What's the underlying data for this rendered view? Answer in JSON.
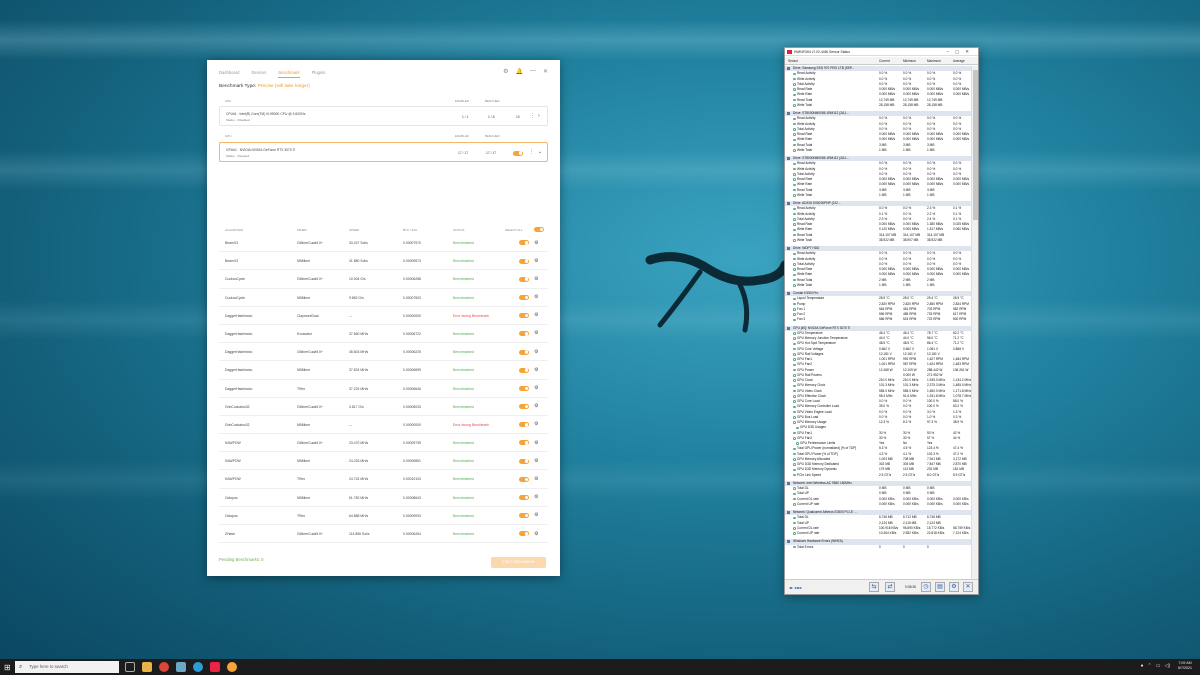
{
  "app": {
    "nav": [
      "Dashboard",
      "Devices",
      "Benchmark",
      "Plugins"
    ],
    "nav_active": 2,
    "benchmark_type_label": "Benchmark Type:",
    "benchmark_type_value": "Precise (will take longer)",
    "cpu_section": {
      "header": "CPU",
      "col_enabled": "ENABLED",
      "col_bench": "BENCHED",
      "device": "CPU#1 · Intel(R) Core(TM) i9-9900K CPU @ 3.60GHz",
      "status": "Status · Disabled",
      "enabled": "1 / 1",
      "benched": "1 / 8",
      "extra": "10"
    },
    "gpu_section": {
      "header": "GPU",
      "col_enabled": "ENABLED",
      "col_bench": "BENCHED",
      "device": "GPU#1 · NVIDIA NVIDIA GeForce RTX 3070 Ti",
      "status": "Status · Stopped",
      "enabled": "17 / 17",
      "benched": "17 / 17"
    },
    "algo_headers": {
      "algorithm": "ALGORITHM",
      "miner": "MINER",
      "speed": "SPEED",
      "btc": "BTC / 24H",
      "status": "STATUS",
      "select_all": "SELECT ALL"
    },
    "algorithms": [
      {
        "algo": "BeamV3",
        "miner": "GMinerCuda9.0+",
        "speed": "33.247 Sol/s",
        "btc": "0.00007970",
        "status": "Benchmarked",
        "err": false
      },
      {
        "algo": "BeamV3",
        "miner": "NBMiner",
        "speed": "41.880 Sol/s",
        "btc": "0.00009573",
        "status": "Benchmarked",
        "err": false
      },
      {
        "algo": "CuckooCycle",
        "miner": "GMinerCuda9.0+",
        "speed": "10.004 G/s",
        "btc": "0.00006288",
        "status": "Benchmarked",
        "err": false
      },
      {
        "algo": "CuckooCycle",
        "miner": "NBMiner",
        "speed": "9.852 G/s",
        "btc": "0.00007503",
        "status": "Benchmarked",
        "err": false
      },
      {
        "algo": "DaggerHashimoto",
        "miner": "ClaymoreDual",
        "speed": "---",
        "btc": "0.00000000",
        "status": "Error during Benchmark",
        "err": true
      },
      {
        "algo": "DaggerHashimoto",
        "miner": "Excavator",
        "speed": "37.650 MH/s",
        "btc": "0.00006722",
        "status": "Benchmarked",
        "err": false
      },
      {
        "algo": "DaggerHashimoto",
        "miner": "GMinerCuda9.0+",
        "speed": "38.603 MH/s",
        "btc": "0.00006225",
        "status": "Benchmarked",
        "err": false
      },
      {
        "algo": "DaggerHashimoto",
        "miner": "NBMiner",
        "speed": "37.524 MH/s",
        "btc": "0.00006699",
        "status": "Benchmarked",
        "err": false
      },
      {
        "algo": "DaggerHashimoto",
        "miner": "TRex",
        "speed": "37.224 MH/s",
        "btc": "0.00006646",
        "status": "Benchmarked",
        "err": false
      },
      {
        "algo": "GrinCuckatoo32",
        "miner": "GMinerCuda9.0+",
        "speed": "0.817 G/s",
        "btc": "0.00005033",
        "status": "Benchmarked",
        "err": false
      },
      {
        "algo": "GrinCuckatoo32",
        "miner": "NBMiner",
        "speed": "---",
        "btc": "0.00000000",
        "status": "Error during Benchmark",
        "err": true
      },
      {
        "algo": "KAWPOW",
        "miner": "GMinerCuda9.0+",
        "speed": "23.470 MH/s",
        "btc": "0.00009739",
        "status": "Benchmarked",
        "err": false
      },
      {
        "algo": "KAWPOW",
        "miner": "NBMiner",
        "speed": "24.233 MH/s",
        "btc": "0.00009851",
        "status": "Benchmarked",
        "err": false
      },
      {
        "algo": "KAWPOW",
        "miner": "TRex",
        "speed": "24.724 MH/s",
        "btc": "0.00010103",
        "status": "Benchmarked",
        "err": false
      },
      {
        "algo": "Octopus",
        "miner": "NBMiner",
        "speed": "61.782 MH/s",
        "btc": "0.00008643",
        "status": "Benchmarked",
        "err": false
      },
      {
        "algo": "Octopus",
        "miner": "TRex",
        "speed": "64.888 MH/s",
        "btc": "0.00009093",
        "status": "Benchmarked",
        "err": false
      },
      {
        "algo": "ZHash",
        "miner": "GMinerCuda9.0+",
        "speed": "114.856 Sol/s",
        "btc": "0.00006264",
        "status": "Benchmarked",
        "err": false
      }
    ],
    "pending": "Pending Benchmarks: 0",
    "start_button": "START BENCHMARK",
    "accent": "#f09a32"
  },
  "hw": {
    "title": "HWiNFO64 v7.02-4460 Sensor Status",
    "columns": [
      "Sensor",
      "Current",
      "Minimum",
      "Maximum",
      "Average"
    ],
    "time": "0:05:26",
    "rows": [
      {
        "g": "Drive: Samsung SSD 970 PRO 1TB (S5P..."
      },
      [
        "Read Activity",
        "0.0 %",
        "0.0 %",
        "0.0 %",
        "0.0 %"
      ],
      [
        "Write Activity",
        "0.0 %",
        "0.0 %",
        "0.0 %",
        "0.0 %"
      ],
      [
        "Total Activity",
        "0.0 %",
        "0.0 %",
        "0.0 %",
        "0.0 %"
      ],
      [
        "Read Rate",
        "0.000 MB/s",
        "0.000 MB/s",
        "0.000 MB/s",
        "0.000 MB/s"
      ],
      [
        "Write Rate",
        "0.000 MB/s",
        "0.000 MB/s",
        "0.000 MB/s",
        "0.000 MB/s"
      ],
      [
        "Read Total",
        "12,749 MB",
        "12,749 MB",
        "12,749 MB",
        ""
      ],
      [
        "Write Total",
        "28,158 MB",
        "28,158 MB",
        "28,158 MB",
        ""
      ],
      {
        "sp": 1
      },
      {
        "g": "Drive: ST8000NM0055-1RM112 (ZA1..."
      },
      [
        "Read Activity",
        "0.0 %",
        "0.0 %",
        "0.0 %",
        "0.0 %"
      ],
      [
        "Write Activity",
        "0.0 %",
        "0.0 %",
        "0.0 %",
        "0.0 %"
      ],
      [
        "Total Activity",
        "0.0 %",
        "0.0 %",
        "0.0 %",
        "0.0 %"
      ],
      [
        "Read Rate",
        "0.000 MB/s",
        "0.000 MB/s",
        "0.000 MB/s",
        "0.000 MB/s"
      ],
      [
        "Write Rate",
        "0.000 MB/s",
        "0.000 MB/s",
        "0.000 MB/s",
        "0.000 MB/s"
      ],
      [
        "Read Total",
        "3 MB",
        "3 MB",
        "3 MB",
        ""
      ],
      [
        "Write Total",
        "1 MB",
        "1 MB",
        "1 MB",
        ""
      ],
      {
        "sp": 1
      },
      {
        "g": "Drive: ST8000NM0055-1RM112 (ZA1..."
      },
      [
        "Read Activity",
        "0.0 %",
        "0.0 %",
        "0.0 %",
        "0.0 %"
      ],
      [
        "Write Activity",
        "0.0 %",
        "0.0 %",
        "0.0 %",
        "0.0 %"
      ],
      [
        "Total Activity",
        "0.0 %",
        "0.0 %",
        "0.0 %",
        "0.0 %"
      ],
      [
        "Read Rate",
        "0.000 MB/s",
        "0.000 MB/s",
        "0.000 MB/s",
        "0.000 MB/s"
      ],
      [
        "Write Rate",
        "0.000 MB/s",
        "0.000 MB/s",
        "0.000 MB/s",
        "0.000 MB/s"
      ],
      [
        "Read Total",
        "3 MB",
        "3 MB",
        "3 MB",
        ""
      ],
      [
        "Write Total",
        "1 MB",
        "1 MB",
        "1 MB",
        ""
      ],
      {
        "sp": 1
      },
      {
        "g": "Drive: ADATA SX8200PNP (2J2..."
      },
      [
        "Read Activity",
        "0.0 %",
        "0.0 %",
        "2.3 %",
        "0.1 %"
      ],
      [
        "Write Activity",
        "0.1 %",
        "0.0 %",
        "2.2 %",
        "0.1 %"
      ],
      [
        "Total Activity",
        "2.3 %",
        "0.0 %",
        "2.4 %",
        "0.1 %"
      ],
      [
        "Read Rate",
        "0.000 MB/s",
        "0.000 MB/s",
        "1.380 MB/s",
        "0.025 MB/s"
      ],
      [
        "Write Rate",
        "0.120 MB/s",
        "0.000 MB/s",
        "1.517 MB/s",
        "0.060 MB/s"
      ],
      [
        "Read Total",
        "314,107 MB",
        "314,107 MB",
        "314,107 MB",
        ""
      ],
      [
        "Write Total",
        "38,922 MB",
        "38,907 MB",
        "38,922 MB",
        ""
      ],
      {
        "sp": 1
      },
      {
        "g": "Drive: WDPT HDD"
      },
      [
        "Read Activity",
        "0.0 %",
        "0.0 %",
        "0.0 %",
        "0.0 %"
      ],
      [
        "Write Activity",
        "0.0 %",
        "0.0 %",
        "0.0 %",
        "0.0 %"
      ],
      [
        "Total Activity",
        "0.0 %",
        "0.0 %",
        "0.0 %",
        "0.0 %"
      ],
      [
        "Read Rate",
        "0.000 MB/s",
        "0.000 MB/s",
        "0.000 MB/s",
        "0.000 MB/s"
      ],
      [
        "Write Rate",
        "0.000 MB/s",
        "0.000 MB/s",
        "0.000 MB/s",
        "0.000 MB/s"
      ],
      [
        "Read Total",
        "2 MB",
        "2 MB",
        "2 MB",
        ""
      ],
      [
        "Write Total",
        "1 MB",
        "1 MB",
        "1 MB",
        ""
      ],
      {
        "sp": 1
      },
      {
        "g": "Corsair H150i Pro"
      },
      [
        "Liquid Temperature",
        "28.9 °C",
        "28.0 °C",
        "29.4 °C",
        "28.9 °C"
      ],
      [
        "Pump",
        "2,820 RPM",
        "2,820 RPM",
        "2,850 RPM",
        "2,834 RPM"
      ],
      [
        "Fan 1",
        "564 RPM",
        "461 RPM",
        "703 RPM",
        "582 RPM"
      ],
      [
        "Fan 2",
        "596 RPM",
        "485 RPM",
        "733 RPM",
        "617 RPM"
      ],
      [
        "Fan 3",
        "586 RPM",
        "524 RPM",
        "723 RPM",
        "600 RPM"
      ],
      {
        "sp": 1
      },
      {
        "g": "GPU [#0]: NVIDIA GeForce RTX 3070 Ti"
      },
      [
        "GPU Temperature",
        "45.4 °C",
        "45.4 °C",
        "78.7 °C",
        "62.2 °C"
      ],
      [
        "GPU Memory Junction Temperature",
        "44.0 °C",
        "44.0 °C",
        "96.0 °C",
        "71.2 °C"
      ],
      [
        "GPU Hot Spot Temperature",
        "48.5 °C",
        "48.5 °C",
        "86.4 °C",
        "71.2 °C"
      ],
      [
        "GPU Core Voltage",
        "0.662 V",
        "0.662 V",
        "1.081 V",
        "0.868 V"
      ],
      [
        "GPU Rail Voltages",
        "12.181 V",
        "12.181 V",
        "12.181 V",
        ""
      ],
      [
        "GPU Fan1",
        "1,001 RPM",
        "992 RPM",
        "1,627 RPM",
        "1,484 RPM"
      ],
      [
        "GPU Fan2",
        "1,001 RPM",
        "987 RPM",
        "1,624 RPM",
        "1,483 RPM"
      ],
      [
        "GPU Power",
        "12.468 W",
        "12.109 W",
        "288.442 W",
        "136.261 W"
      ],
      [
        "GPU Rail Powers",
        "",
        "0.000 W",
        "271.952 W",
        ""
      ],
      [
        "GPU Clock",
        "210.0 MHz",
        "210.0 MHz",
        "1,935.0 MHz",
        "1,134.2 MHz"
      ],
      [
        "GPU Memory Clock",
        "101.3 MHz",
        "101.3 MHz",
        "2,375.3 MHz",
        "1,485.0 MHz"
      ],
      [
        "GPU Video Clock",
        "555.0 MHz",
        "555.0 MHz",
        "1,650.0 MHz",
        "1,171.8 MHz"
      ],
      [
        "GPU Effective Clock",
        "58.3 MHz",
        "51.6 MHz",
        "1,931.8 MHz",
        "1,078.7 MHz"
      ],
      [
        "GPU Core Load",
        "0.0 %",
        "0.0 %",
        "100.0 %",
        "58.0 %"
      ],
      [
        "GPU Memory Controller Load",
        "35.0 %",
        "0.0 %",
        "100.0 %",
        "63.2 %"
      ],
      [
        "GPU Video Engine Load",
        "0.0 %",
        "0.0 %",
        "3.0 %",
        "1.3 %"
      ],
      [
        "GPU Bus Load",
        "0.0 %",
        "0.0 %",
        "1.0 %",
        "0.3 %"
      ],
      [
        "GPU Memory Usage",
        "12.3 %",
        "8.3 %",
        "97.3 %",
        "38.9 %"
      ],
      [
        "GPU D3D Usages",
        "",
        "",
        "",
        "",
        1
      ],
      [
        "GPU Fan1",
        "30 %",
        "30 %",
        "53 %",
        "42 %"
      ],
      [
        "GPU Fan2",
        "30 %",
        "30 %",
        "57 %",
        "44 %"
      ],
      [
        "GPU Performance Limits",
        "Yes",
        "No",
        "Yes",
        "",
        1
      ],
      [
        "Total GPU Power (normalized) [% of TDP]",
        "5.3 %",
        "4.5 %",
        "123.4 %",
        "47.4 %"
      ],
      [
        "Total GPU Power [% of TDP]",
        "4.3 %",
        "4.1 %",
        "102.3 %",
        "47.2 %"
      ],
      [
        "GPU Memory Allocated",
        "1,003 MB",
        "708 MB",
        "7,941 MB",
        "3,172 MB"
      ],
      [
        "GPU D3D Memory Dedicated",
        "302 MB",
        "304 MB",
        "7,847 MB",
        "2,870 MB"
      ],
      [
        "GPU D3D Memory Dynamic",
        "179 MB",
        "113 MB",
        "232 MB",
        "181 MB"
      ],
      [
        "PCIe Link Speed",
        "2.5 GT/s",
        "2.5 GT/s",
        "8.0 GT/s",
        "5.9 GT/s"
      ],
      {
        "sp": 1
      },
      {
        "g": "Network: Intel Wireless-AC 9560 160MHz"
      },
      [
        "Total DL",
        "0 MB",
        "0 MB",
        "0 MB",
        ""
      ],
      [
        "Total UP",
        "0 MB",
        "0 MB",
        "0 MB",
        ""
      ],
      [
        "Current DL rate",
        "0.000 KB/s",
        "0.000 KB/s",
        "0.000 KB/s",
        "0.000 KB/s"
      ],
      [
        "Current UP rate",
        "0.000 KB/s",
        "0.000 KB/s",
        "0.000 KB/s",
        "0.000 KB/s"
      ],
      {
        "sp": 1
      },
      {
        "g": "Network: Qualcomm Atheros E2500 PCI-E ..."
      },
      [
        "Total DL",
        "6,746 MB",
        "6,712 MB",
        "6,746 MB",
        ""
      ],
      [
        "Total UP",
        "2,124 MB",
        "2,115 MB",
        "2,124 MB",
        ""
      ],
      [
        "Current DL rate",
        "100.918 KB/s",
        "95.890 KB/s",
        "15,772 KB/s",
        "58.759 KB/s"
      ],
      [
        "Current UP rate",
        "10.464 KB/s",
        "2.552 KB/s",
        "22.818 KB/s",
        "7.124 KB/s"
      ],
      {
        "sp": 1
      },
      {
        "g": "Windows Hardware Errors (WHEA)"
      },
      [
        "Total Errors",
        "0",
        "0",
        "0",
        ""
      ]
    ]
  },
  "taskbar": {
    "search_placeholder": "Type here to search",
    "time": "7:09 AM",
    "date": "6/7/2021"
  }
}
